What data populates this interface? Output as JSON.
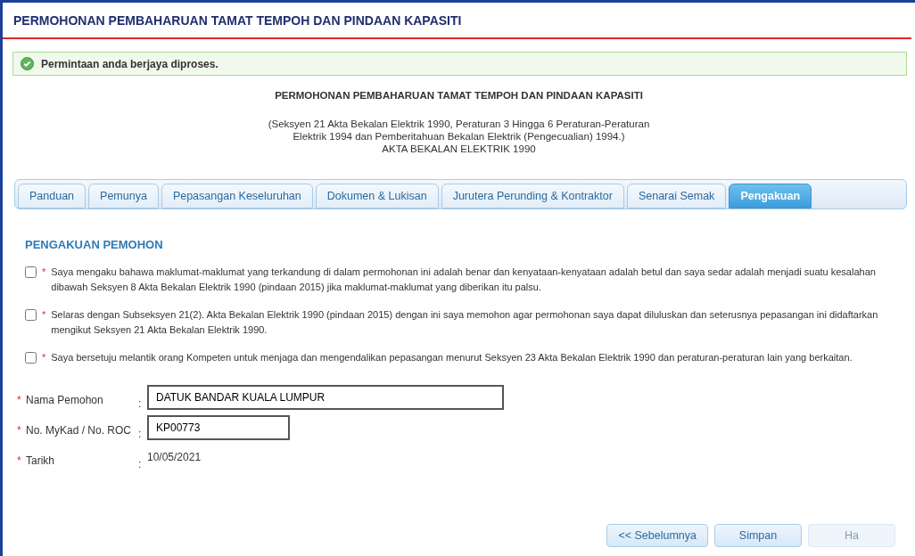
{
  "page_title": "PERMOHONAN PEMBAHARUAN TAMAT TEMPOH DAN PINDAAN KAPASITI",
  "success_message": "Permintaan anda berjaya diproses.",
  "form_heading": {
    "title": "PERMOHONAN PEMBAHARUAN TAMAT TEMPOH DAN PINDAAN KAPASITI",
    "subtitle_lines": [
      "(Seksyen 21 Akta Bekalan Elektrik 1990, Peraturan 3 Hingga 6 Peraturan-Peraturan",
      "Elektrik 1994 dan Pemberitahuan Bekalan Elektrik (Pengecualian) 1994.)",
      "AKTA BEKALAN ELEKTRIK 1990"
    ]
  },
  "tabs": [
    {
      "label": "Panduan",
      "selected": false
    },
    {
      "label": "Pemunya",
      "selected": false
    },
    {
      "label": "Pepasangan Keseluruhan",
      "selected": false
    },
    {
      "label": "Dokumen & Lukisan",
      "selected": false
    },
    {
      "label": "Jurutera Perunding & Kontraktor",
      "selected": false
    },
    {
      "label": "Senarai Semak",
      "selected": false
    },
    {
      "label": "Pengakuan",
      "selected": true
    }
  ],
  "section_title": "PENGAKUAN PEMOHON",
  "declarations": [
    {
      "required_mark": "*",
      "text": "Saya mengaku bahawa maklumat-maklumat yang terkandung di dalam permohonan ini adalah benar dan kenyataan-kenyataan adalah betul dan saya sedar adalah menjadi suatu kesalahan dibawah Seksyen 8 Akta Bekalan Elektrik 1990 (pindaan 2015) jika maklumat-maklumat yang diberikan itu palsu.",
      "checked": false
    },
    {
      "required_mark": "*",
      "text": "Selaras dengan Subseksyen 21(2). Akta Bekalan Elektrik 1990 (pindaan 2015) dengan ini saya memohon agar permohonan saya dapat diluluskan dan seterusnya pepasangan ini didaftarkan mengikut Seksyen 21 Akta Bekalan Elektrik 1990.",
      "checked": false
    },
    {
      "required_mark": "*",
      "text": "Saya bersetuju melantik orang Kompeten untuk menjaga dan mengendalikan pepasangan menurut Seksyen 23 Akta Bekalan Elektrik 1990 dan peraturan-peraturan lain yang berkaitan.",
      "checked": false
    }
  ],
  "fields": [
    {
      "kind": "input",
      "required_mark": "*",
      "label": "Nama Pemohon",
      "separator": ":",
      "value": "DATUK BANDAR KUALA LUMPUR"
    },
    {
      "kind": "shortinput",
      "required_mark": "*",
      "label": "No. MyKad / No. ROC",
      "separator": ":",
      "value": "KP00773"
    },
    {
      "kind": "text",
      "required_mark": "*",
      "label": "Tarikh",
      "separator": ":",
      "value": "10/05/2021"
    }
  ],
  "buttons": [
    {
      "label": "<< Sebelumnya",
      "disabled": false
    },
    {
      "label": "Simpan",
      "disabled": false
    },
    {
      "label": "Ha",
      "disabled": true
    }
  ]
}
